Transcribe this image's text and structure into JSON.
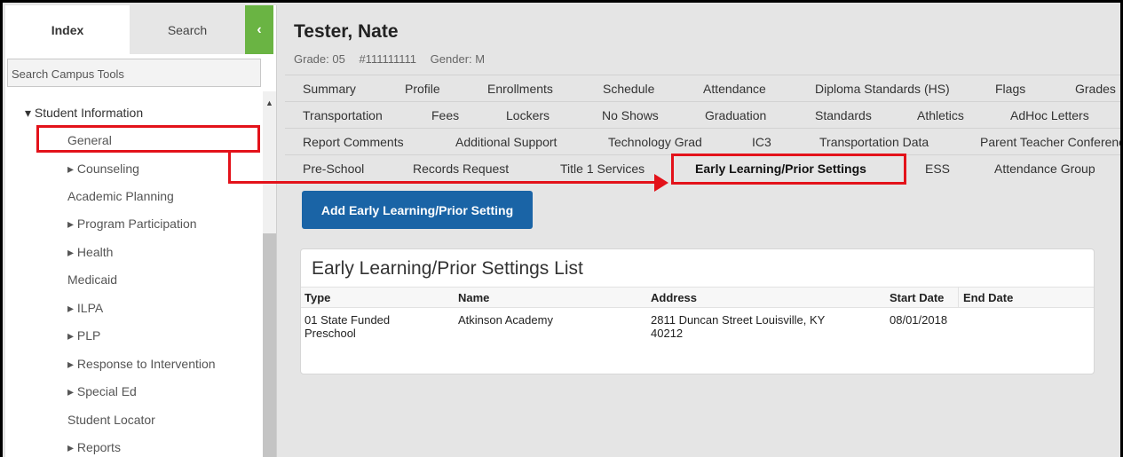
{
  "left_panel": {
    "tabs": {
      "index": "Index",
      "search": "Search",
      "collapse_icon": "chevron-left-icon"
    },
    "campus_search": {
      "placeholder": "Search Campus Tools"
    },
    "tree": [
      {
        "label": "▾ Student Information"
      },
      {
        "label": "General"
      },
      {
        "label": "▸ Counseling"
      },
      {
        "label": "Academic Planning"
      },
      {
        "label": "▸ Program Participation"
      },
      {
        "label": "▸ Health"
      },
      {
        "label": "Medicaid"
      },
      {
        "label": "▸ ILPA"
      },
      {
        "label": "▸ PLP"
      },
      {
        "label": "▸ Response to Intervention"
      },
      {
        "label": "▸ Special Ed"
      },
      {
        "label": "Student Locator"
      },
      {
        "label": "▸ Reports"
      }
    ]
  },
  "student": {
    "name": "Tester, Nate",
    "grade": "Grade: 05",
    "id": "#111111111",
    "gender": "Gender: M"
  },
  "tab_rows": [
    [
      "Summary",
      "Profile",
      "Enrollments",
      "Schedule",
      "Attendance",
      "Diploma Standards (HS)",
      "Flags",
      "Grades"
    ],
    [
      "Transportation",
      "Fees",
      "Lockers",
      "No Shows",
      "Graduation",
      "Standards",
      "Athletics",
      "AdHoc Letters"
    ],
    [
      "Report Comments",
      "Additional Support",
      "Technology Grad",
      "IC3",
      "Transportation Data",
      "Parent Teacher Conferences"
    ],
    [
      "Pre-School",
      "Records Request",
      "Title 1 Services",
      "Early Learning/Prior Settings",
      "ESS",
      "Attendance Group"
    ]
  ],
  "active_tab": "Early Learning/Prior Settings",
  "add_button": "Add Early Learning/Prior Setting",
  "list": {
    "title": "Early Learning/Prior Settings List",
    "columns": [
      "Type",
      "Name",
      "Address",
      "Start Date",
      "End Date"
    ],
    "rows": [
      {
        "type_line1": "01 State Funded",
        "type_line2": "Preschool",
        "name": "Atkinson Academy",
        "address_line1": "2811 Duncan Street Louisville, KY",
        "address_line2": "40212",
        "start_date": "08/01/2018",
        "end_date": ""
      }
    ]
  },
  "colors": {
    "highlight": "#e3121a",
    "primary_button": "#1a64a6",
    "collapse_tab": "#6ab443"
  }
}
